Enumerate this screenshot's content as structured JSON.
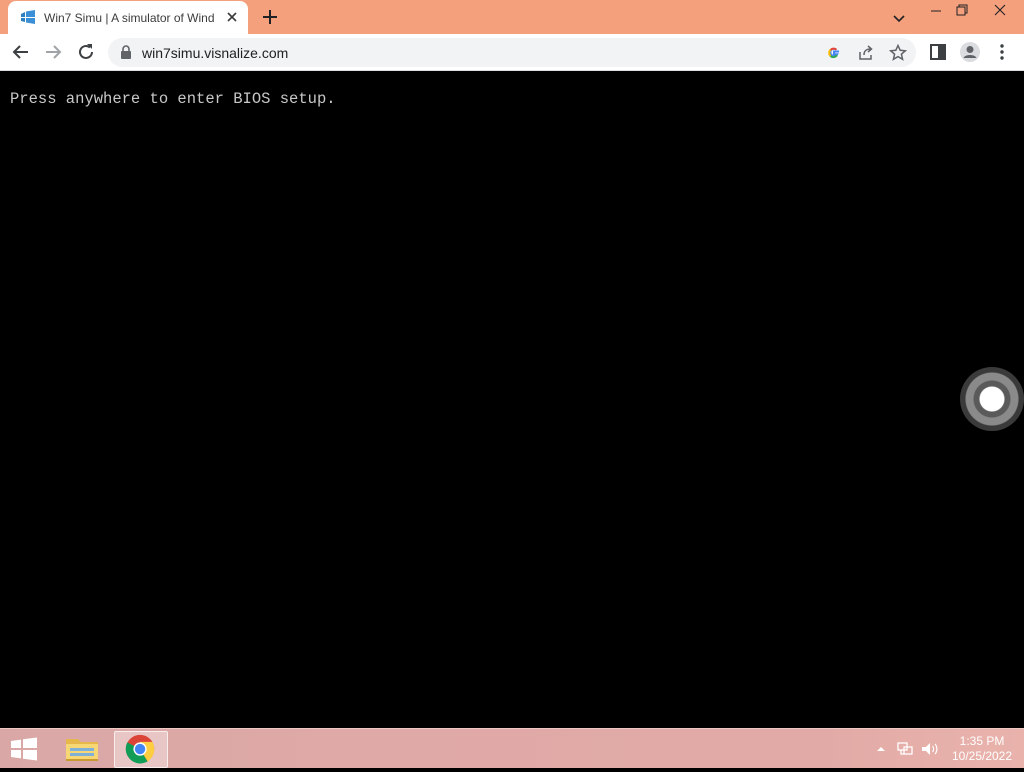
{
  "browser": {
    "tab": {
      "title": "Win7 Simu | A simulator of Wind"
    },
    "address_bar": {
      "url": "win7simu.visnalize.com"
    }
  },
  "page": {
    "bios_message": "Press anywhere to enter BIOS setup."
  },
  "taskbar": {
    "clock": {
      "time": "1:35 PM",
      "date": "10/25/2022"
    }
  },
  "colors": {
    "titlebar": "#f4a07c",
    "page_background": "#000000",
    "bios_text": "#c8c8c8"
  }
}
